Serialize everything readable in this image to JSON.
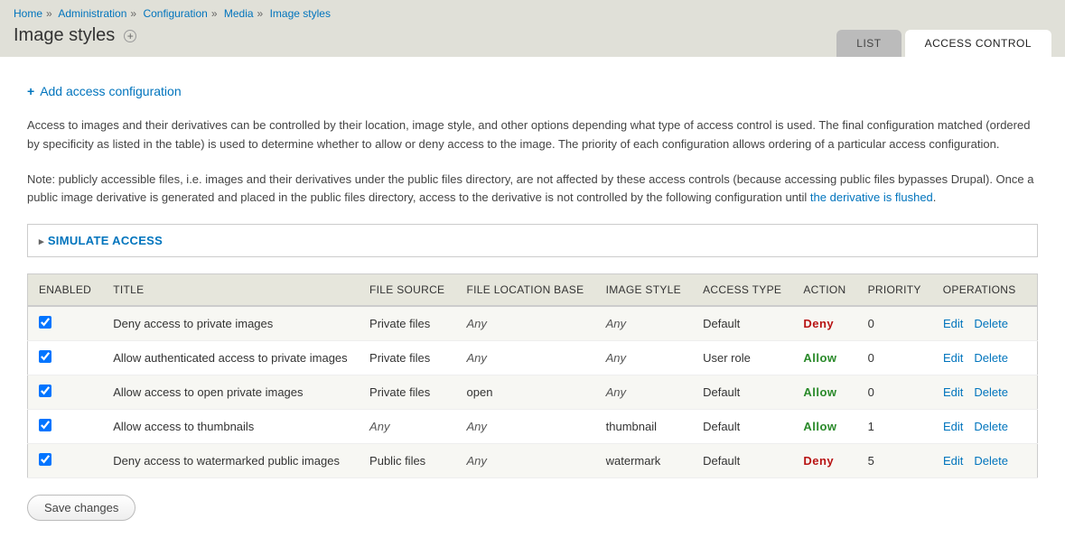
{
  "breadcrumb": {
    "items": [
      "Home",
      "Administration",
      "Configuration",
      "Media",
      "Image styles"
    ]
  },
  "page_title": "Image styles",
  "tabs": {
    "list": "List",
    "access": "Access control"
  },
  "action_link": "Add access configuration",
  "description1": "Access to images and their derivatives can be controlled by their location, image style, and other options depending what type of access control is used. The final configuration matched (ordered by specificity as listed in the table) is used to determine whether to allow or deny access to the image. The priority of each configuration allows ordering of a particular access configuration.",
  "description2_pre": "Note: publicly accessible files, i.e. images and their derivatives under the public files directory, are not affected by these access controls (because accessing public files bypasses Drupal). Once a public image derivative is generated and placed in the public files directory, access to the derivative is not controlled by the following configuration until ",
  "description2_link": "the derivative is flushed",
  "description2_post": ".",
  "fieldset_title": "SIMULATE ACCESS",
  "table": {
    "headers": {
      "enabled": "ENABLED",
      "title": "TITLE",
      "file_source": "FILE SOURCE",
      "file_location": "FILE LOCATION BASE",
      "image_style": "IMAGE STYLE",
      "access_type": "ACCESS TYPE",
      "action": "ACTION",
      "priority": "PRIORITY",
      "operations": "OPERATIONS"
    },
    "rows": [
      {
        "enabled": true,
        "title": "Deny access to private images",
        "file_source": "Private files",
        "file_location": "Any",
        "file_location_italic": true,
        "image_style": "Any",
        "image_style_italic": true,
        "access_type": "Default",
        "action": "Deny",
        "priority": "0"
      },
      {
        "enabled": true,
        "title": "Allow authenticated access to private images",
        "file_source": "Private files",
        "file_location": "Any",
        "file_location_italic": true,
        "image_style": "Any",
        "image_style_italic": true,
        "access_type": "User role",
        "action": "Allow",
        "priority": "0"
      },
      {
        "enabled": true,
        "title": "Allow access to open private images",
        "file_source": "Private files",
        "file_location": "open",
        "file_location_italic": false,
        "image_style": "Any",
        "image_style_italic": true,
        "access_type": "Default",
        "action": "Allow",
        "priority": "0"
      },
      {
        "enabled": true,
        "title": "Allow access to thumbnails",
        "file_source": "Any",
        "file_source_italic": true,
        "file_location": "Any",
        "file_location_italic": true,
        "image_style": "thumbnail",
        "image_style_italic": false,
        "access_type": "Default",
        "action": "Allow",
        "priority": "1"
      },
      {
        "enabled": true,
        "title": "Deny access to watermarked public images",
        "file_source": "Public files",
        "file_location": "Any",
        "file_location_italic": true,
        "image_style": "watermark",
        "image_style_italic": false,
        "access_type": "Default",
        "action": "Deny",
        "priority": "5"
      }
    ],
    "op_edit": "Edit",
    "op_delete": "Delete"
  },
  "save_button": "Save changes"
}
